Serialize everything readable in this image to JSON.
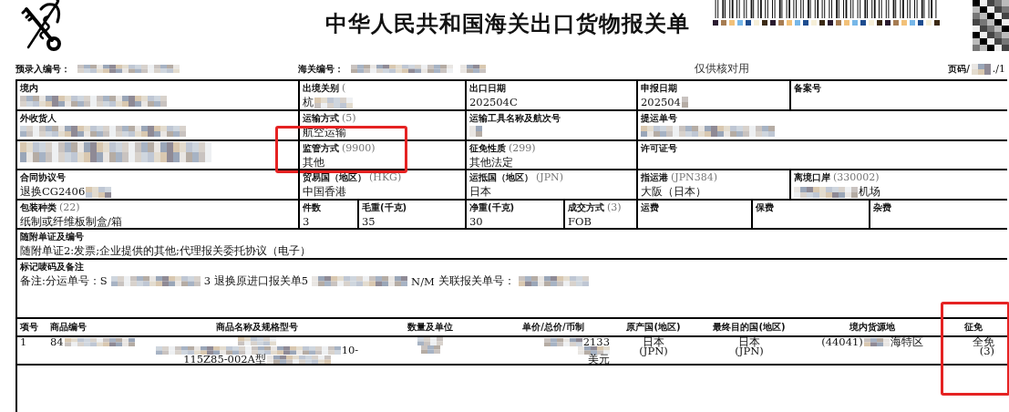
{
  "header": {
    "title": "中华人民共和国海关出口货物报关单",
    "meta": [
      {
        "label": "预录入编号：",
        "value": [
          {
            "kind": "mosaic"
          }
        ]
      },
      {
        "label": "海关编号：",
        "value": [
          {
            "kind": "mosaic"
          },
          {
            "kind": "mosaic"
          }
        ]
      }
    ],
    "note": "仅供核对用",
    "page": {
      "label": "页码/",
      "value": [
        {
          "kind": "mosaic"
        },
        {
          "kind": "text",
          "text": "./1"
        }
      ]
    }
  },
  "form_rows": [
    [
      {
        "label": "境内",
        "value": [
          {
            "kind": "mosaic"
          }
        ]
      },
      {
        "label": "出境关别",
        "code": "(",
        "value": [
          {
            "kind": "text",
            "text": "杭"
          },
          {
            "kind": "mosaic"
          }
        ]
      },
      {
        "label": "出口日期",
        "value": [
          {
            "kind": "text",
            "text": "202504C"
          }
        ]
      },
      {
        "label": "申报日期",
        "value": [
          {
            "kind": "text",
            "text": "202504"
          },
          {
            "kind": "mosaic"
          }
        ]
      },
      {
        "label": "备案号"
      }
    ],
    [
      {
        "label": "外收货人",
        "value": [
          {
            "kind": "mosaic"
          }
        ]
      },
      {
        "label": "运输方式",
        "code": "(5)",
        "value": [
          {
            "kind": "text",
            "text": "航空运输"
          }
        ]
      },
      {
        "label": "运输工具名称及航次号",
        "value": [
          {
            "kind": "mosaic"
          }
        ]
      },
      {
        "label": "提运单号",
        "value": [
          {
            "kind": "mosaic"
          }
        ]
      }
    ],
    [
      {
        "value": [
          {
            "kind": "mosaic"
          }
        ]
      },
      {
        "label": "监管方式",
        "code": "(9900)",
        "value": [
          {
            "kind": "text",
            "text": "其他"
          }
        ],
        "highlighted": true
      },
      {
        "label": "征免性质",
        "code": "(299)",
        "value": [
          {
            "kind": "text",
            "text": "其他法定"
          }
        ]
      },
      {
        "label": "许可证号"
      }
    ],
    [
      {
        "label": "合同协议号",
        "value": [
          {
            "kind": "text",
            "text": "退换CG2406"
          },
          {
            "kind": "mosaic"
          }
        ]
      },
      {
        "label": "贸易国（地区）",
        "code": "(HKG)",
        "value": [
          {
            "kind": "text",
            "text": "中国香港"
          }
        ]
      },
      {
        "label": "运抵国（地区）",
        "code": "(JPN)",
        "value": [
          {
            "kind": "text",
            "text": "日本"
          }
        ]
      },
      {
        "label": "指运港",
        "code": "(JPN384)",
        "value": [
          {
            "kind": "text",
            "text": "大阪（日本）"
          }
        ]
      },
      {
        "label": "离境口岸",
        "code": "(330002)",
        "value": [
          {
            "kind": "mosaic"
          },
          {
            "kind": "text",
            "text": "机场"
          }
        ]
      }
    ],
    [
      {
        "label": "包装种类",
        "code": "(22)",
        "value": [
          {
            "kind": "text",
            "text": "纸制或纤维板制盒/箱"
          }
        ]
      },
      {
        "label": "件数",
        "value": [
          {
            "kind": "text",
            "text": "3"
          }
        ]
      },
      {
        "label": "毛重(千克)",
        "value": [
          {
            "kind": "text",
            "text": "35"
          }
        ]
      },
      {
        "label": "净重(千克)",
        "value": [
          {
            "kind": "text",
            "text": "30"
          }
        ]
      },
      {
        "label": "成交方式",
        "code": "(3)",
        "value": [
          {
            "kind": "text",
            "text": "FOB"
          }
        ]
      },
      {
        "label": "运费"
      },
      {
        "label": "保费"
      },
      {
        "label": "杂费"
      }
    ]
  ],
  "attachments": {
    "label": "随附单证及编号",
    "value": "随附单证2:发票;企业提供的其他;代理报关委托协议（电子）"
  },
  "remarks": {
    "label": "标记唛码及备注",
    "value": [
      {
        "kind": "text",
        "text": "备注:分运单号：S"
      },
      {
        "kind": "mosaic"
      },
      {
        "kind": "text",
        "text": "3 退换原进口报关单5"
      },
      {
        "kind": "mosaic"
      },
      {
        "kind": "text",
        "text": "N/M"
      },
      {
        "kind": "text",
        "text": "关联报关单号："
      },
      {
        "kind": "mosaic"
      }
    ]
  },
  "goods": {
    "columns": [
      {
        "label": "项号",
        "highlighted": false
      },
      {
        "label": "商品编号",
        "highlighted": false
      },
      {
        "label": "商品名称及规格型号",
        "highlighted": false
      },
      {
        "label": "数量及单位",
        "highlighted": false
      },
      {
        "label": "单价/总价/币制",
        "highlighted": false
      },
      {
        "label": "原产国(地区)",
        "highlighted": false
      },
      {
        "label": "最终目的国(地区)",
        "highlighted": false
      },
      {
        "label": "境内货源地",
        "highlighted": false
      },
      {
        "label": "征免",
        "highlighted": true
      }
    ],
    "rows": [
      {
        "cells": [
          [
            [
              {
                "kind": "text",
                "text": "1"
              }
            ]
          ],
          [
            [
              {
                "kind": "text",
                "text": "84"
              },
              {
                "kind": "mosaic"
              }
            ]
          ],
          [
            [
              {
                "kind": "mosaic"
              }
            ],
            [
              {
                "kind": "mosaic"
              },
              {
                "kind": "text",
                "text": "10-"
              }
            ],
            [
              {
                "kind": "text",
                "text": "115Z85-002A型"
              },
              {
                "kind": "mosaic"
              }
            ]
          ],
          [
            [
              {
                "kind": "mosaic"
              }
            ],
            [
              {
                "kind": "mosaic"
              }
            ]
          ],
          [
            [
              {
                "kind": "mosaic"
              },
              {
                "kind": "text",
                "text": "2133"
              }
            ],
            [
              {
                "kind": "mosaic"
              }
            ],
            [
              {
                "kind": "text",
                "text": "美元"
              }
            ]
          ],
          [
            [
              {
                "kind": "text",
                "text": "日本"
              }
            ],
            [
              {
                "kind": "text",
                "text": "(JPN)"
              }
            ]
          ],
          [
            [
              {
                "kind": "text",
                "text": "日本"
              }
            ],
            [
              {
                "kind": "text",
                "text": "(JPN)"
              }
            ]
          ],
          [
            [
              {
                "kind": "text",
                "text": "(44041)"
              },
              {
                "kind": "mosaic"
              },
              {
                "kind": "text",
                "text": "海特区"
              }
            ]
          ],
          [
            [
              {
                "kind": "text",
                "text": "全免"
              }
            ],
            [
              {
                "kind": "text",
                "text": "(3)"
              }
            ]
          ]
        ]
      }
    ]
  }
}
